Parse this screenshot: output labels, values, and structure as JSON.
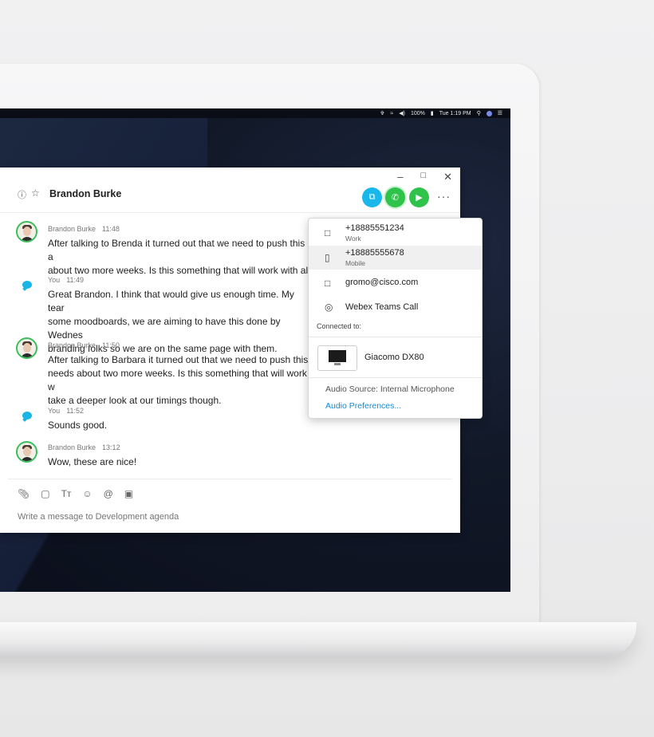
{
  "menubar": {
    "wifi": "□",
    "volume": "◀)",
    "battery": "100%",
    "clock": "Tue 1:19 PM",
    "search": "⌕"
  },
  "conversation": {
    "title": "Brandon Burke",
    "info_icon": "info-icon",
    "star_icon": "star-icon"
  },
  "window_controls": {
    "minimize": "–",
    "maximize": "□",
    "close": "✕"
  },
  "call_buttons": {
    "share_color": "#1ab7ea",
    "audio_color": "#2fc34b",
    "video_color": "#2fc34b"
  },
  "messages": [
    {
      "sender": "Brandon Burke",
      "time": "11:48",
      "text": "After talking to Brenda it turned out that we need to push this a\nabout two more weeks. Is this something that will work with all",
      "type": "avatar"
    },
    {
      "sender": "You",
      "time": "11:49",
      "text": "Great Brandon. I think that would give us enough time. My tear\nsome moodboards, we are aiming to have this done by Wednes\nbranding folks so we are on the same page with them.",
      "type": "you"
    },
    {
      "sender": "Brandon Burke",
      "time": "11:50",
      "text": "After talking to Barbara it turned out that we need to push this\nneeds about two more weeks. Is this something that will work w\ntake a deeper look at our timings though.",
      "type": "avatar"
    },
    {
      "sender": "You",
      "time": "11:52",
      "text": "Sounds good.",
      "type": "you"
    },
    {
      "sender": "Brandon Burke",
      "time": "13:12",
      "text": "Wow, these are nice!",
      "type": "avatar"
    }
  ],
  "composer": {
    "placeholder": "Write a message to Development agenda"
  },
  "call_menu": {
    "options": [
      {
        "number": "+18885551234",
        "type": "Work"
      },
      {
        "number": "+18885555678",
        "type": "Mobile"
      }
    ],
    "email": "gromo@cisco.com",
    "teams_call": "Webex Teams Call",
    "connected_label": "Connected to:",
    "device": "Giacomo DX80",
    "audio_source": "Audio Source: Internal Microphone",
    "audio_preferences": "Audio Preferences..."
  }
}
